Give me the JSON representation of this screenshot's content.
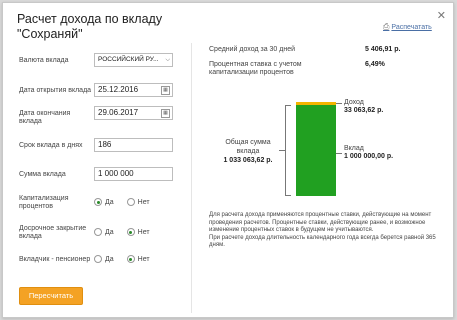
{
  "dialog": {
    "title": "Расчет дохода по вкладу \"Сохраняй\"",
    "close_label": "✕",
    "print_label": "Распечатать"
  },
  "form": {
    "currency": {
      "label": "Валюта вклада",
      "value": "РОССИЙСКИЙ РУ..."
    },
    "open_date": {
      "label": "Дата открытия вклада",
      "value": "25.12.2016"
    },
    "close_date": {
      "label": "Дата окончания вклада",
      "value": "29.06.2017"
    },
    "term": {
      "label": "Срок вклада в днях",
      "value": "186"
    },
    "amount": {
      "label": "Сумма вклада",
      "value": "1 000 000"
    },
    "capitalization": {
      "label": "Капитализация процентов",
      "yes": "Да",
      "no": "Нет",
      "selected": "yes"
    },
    "early_close": {
      "label": "Досрочное закрытие вклада",
      "yes": "Да",
      "no": "Нет",
      "selected": "no"
    },
    "pensioner": {
      "label": "Вкладчик - пенсионер",
      "yes": "Да",
      "no": "Нет",
      "selected": "no"
    },
    "recalc_label": "Пересчитать"
  },
  "results": {
    "avg_income_label": "Средний доход за 30 дней",
    "avg_income_value": "5 406,91 р.",
    "rate_label": "Процентная ставка с учетом капитализации процентов",
    "rate_value": "6,49%",
    "total_label": "Общая сумма вклада",
    "total_value": "1 033 063,62 р.",
    "income_label": "Доход",
    "income_value": "33 063,62 р.",
    "deposit_label": "Вклад",
    "deposit_value": "1 000 000,00 р.",
    "chart": {
      "deposit": 1000000.0,
      "income": 33063.62,
      "deposit_color": "#21a021",
      "income_color": "#f4b400"
    }
  },
  "note": {
    "line1": "Для расчета дохода применяются процентные ставки, действующие на момент проведения расчетов. Процентные ставки, действующие ранее, и возможное изменение процентных ставок в будущем не учитываются.",
    "line2": "При расчете дохода длительность календарного года всегда берется равной 365 дням."
  }
}
